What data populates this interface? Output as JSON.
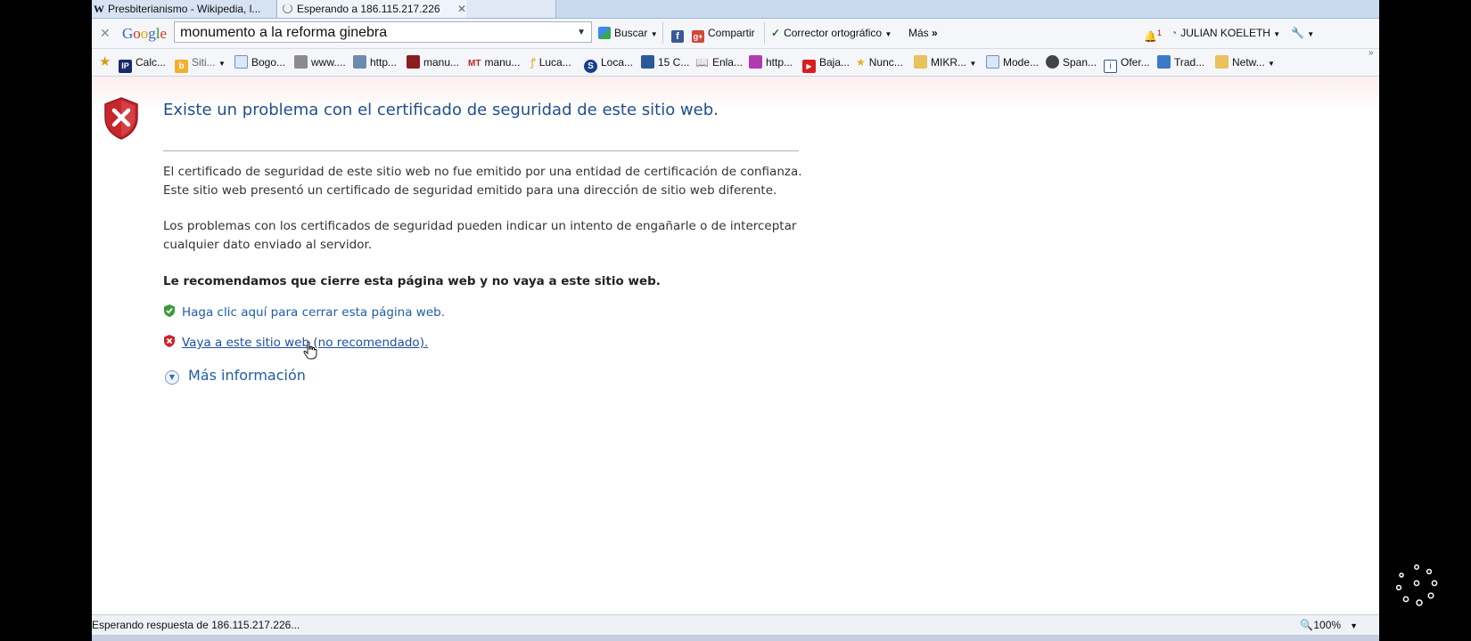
{
  "tabs": [
    {
      "label": "Presbiterianismo - Wikipedia, l...",
      "icon": "wikipedia-icon"
    },
    {
      "label": "Esperando a 186.115.217.226",
      "icon": "loading-icon",
      "close": "✕"
    }
  ],
  "google_toolbar": {
    "logo": "Google",
    "search_value": "monumento a la reforma ginebra",
    "search_button": "Buscar",
    "share_button": "Compartir",
    "spellcheck_button": "Corrector ortográfico",
    "more_button": "Más",
    "notification_count": "1",
    "user_name": "JULIAN KOELETH"
  },
  "favorites": [
    "Calc...",
    "Siti...",
    "Bogo...",
    "www....",
    "http...",
    "manu...",
    "manu...",
    "Luca...",
    "Loca...",
    "15 C...",
    "Enla...",
    "http...",
    "Baja...",
    "Nunc...",
    "MIKR...",
    "Mode...",
    "Span...",
    "Ofer...",
    "Trad...",
    "Netw..."
  ],
  "error_page": {
    "title": "Existe un problema con el certificado de seguridad de este sitio web.",
    "para1": "El certificado de seguridad de este sitio web no fue emitido por una entidad de certificación de confianza.\nEste sitio web presentó un certificado de seguridad emitido para una dirección de sitio web diferente.",
    "para2": "Los problemas con los certificados de seguridad pueden indicar un intento de engañarle o de interceptar\ncualquier dato enviado al servidor.",
    "recommendation": "Le recomendamos que cierre esta página web y no vaya a este sitio web.",
    "close_link": "Haga clic aquí para cerrar esta página web.",
    "continue_link": "Vaya a este sitio web (no recomendado).",
    "more_info": "Más información"
  },
  "statusbar": {
    "status": "Esperando respuesta de 186.115.217.226...",
    "zoom": "100%"
  },
  "colors": {
    "title": "#1f4e8c",
    "link": "#1f5da8",
    "shield_red": "#c8262c",
    "shield_green": "#3a9a3a"
  }
}
